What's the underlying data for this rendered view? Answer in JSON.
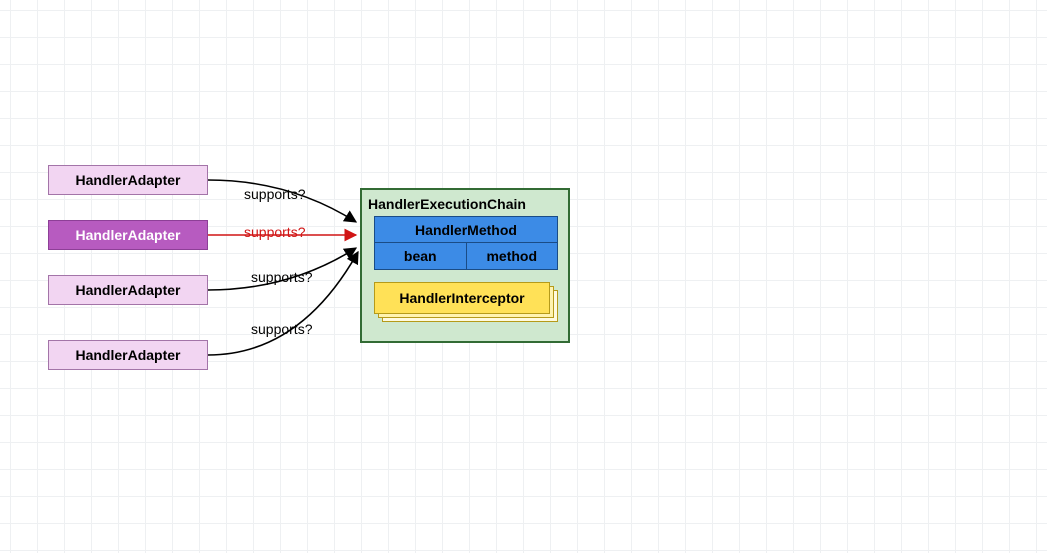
{
  "adapters": [
    {
      "label": "HandlerAdapter",
      "selected": false
    },
    {
      "label": "HandlerAdapter",
      "selected": true
    },
    {
      "label": "HandlerAdapter",
      "selected": false
    },
    {
      "label": "HandlerAdapter",
      "selected": false
    }
  ],
  "edge_labels": {
    "e0": "supports?",
    "e1": "supports?",
    "e2": "supports?",
    "e3": "supports?"
  },
  "chain": {
    "title": "HandlerExecutionChain",
    "handler_method": {
      "title": "HandlerMethod",
      "cells": {
        "bean": "bean",
        "method": "method"
      }
    },
    "interceptor_label": "HandlerInterceptor"
  },
  "colors": {
    "adapter_bg": "#f2d5f2",
    "adapter_selected_bg": "#b75bc0",
    "chain_bg": "#cfe8cf",
    "hm_bg": "#3c8be6",
    "interceptor_bg": "#ffe157",
    "edge_highlight": "#d11515"
  }
}
